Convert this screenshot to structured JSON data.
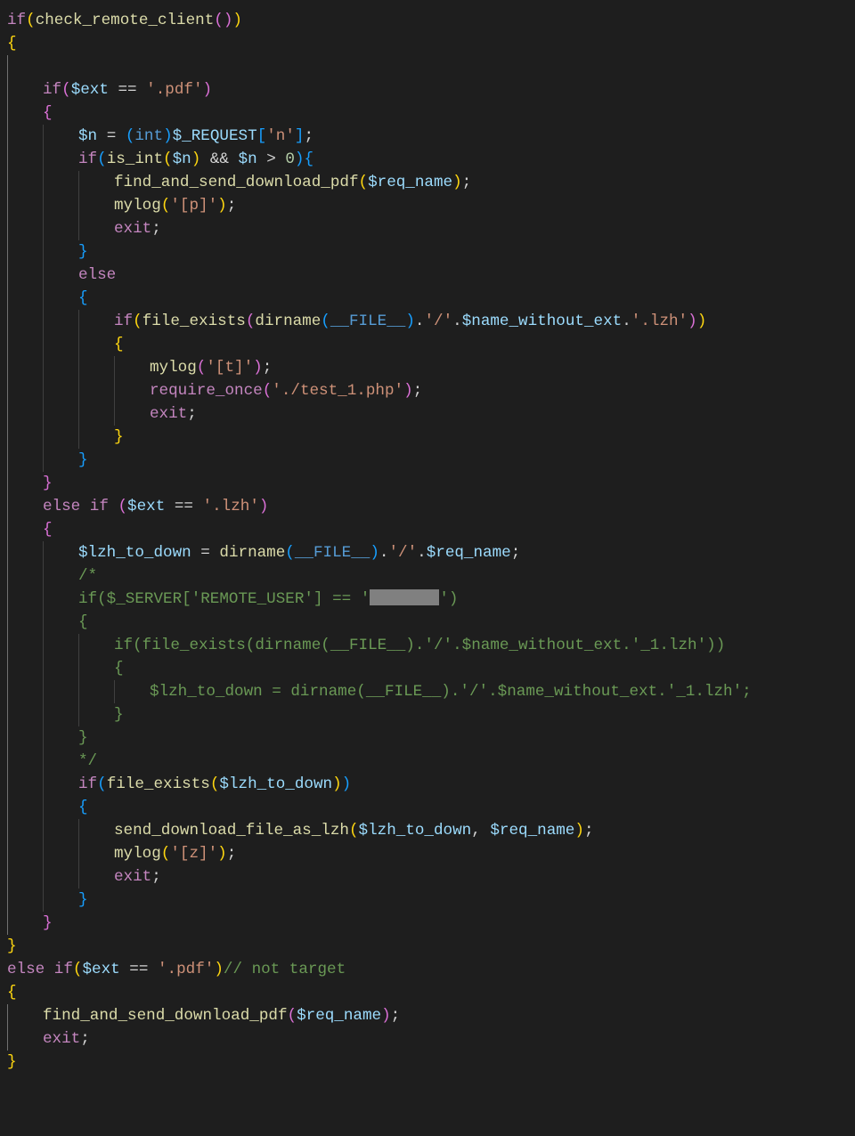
{
  "code": {
    "lines": [
      {
        "i": 0,
        "g": [],
        "h": "<span class=\"kw\">if</span><span class=\"brace\">(</span><span class=\"fn\">check_remote_client</span><span class=\"brack\">(</span><span class=\"brack\">)</span><span class=\"brace\">)</span>"
      },
      {
        "i": 0,
        "g": [],
        "h": "<span class=\"brace\">{</span>"
      },
      {
        "i": 1,
        "g": [
          "a"
        ],
        "h": ""
      },
      {
        "i": 1,
        "g": [
          "a"
        ],
        "h": "<span class=\"kw\">if</span><span class=\"brack\">(</span><span class=\"var\">$ext</span> <span class=\"op\">==</span> <span class=\"str\">'.pdf'</span><span class=\"brack\">)</span>"
      },
      {
        "i": 1,
        "g": [
          "a"
        ],
        "h": "<span class=\"brack\">{</span>"
      },
      {
        "i": 2,
        "g": [
          "a",
          "n"
        ],
        "h": "<span class=\"var\">$n</span> <span class=\"op\">=</span> <span class=\"bracb\">(</span><span class=\"con\">int</span><span class=\"bracb\">)</span><span class=\"var\">$_REQUEST</span><span class=\"bracb\">[</span><span class=\"str\">'n'</span><span class=\"bracb\">]</span>;"
      },
      {
        "i": 2,
        "g": [
          "a",
          "n"
        ],
        "h": "<span class=\"kw\">if</span><span class=\"bracb\">(</span><span class=\"fn\">is_int</span><span class=\"brace\">(</span><span class=\"var\">$n</span><span class=\"brace\">)</span> <span class=\"op\">&amp;&amp;</span> <span class=\"var\">$n</span> <span class=\"op\">&gt;</span> <span class=\"num\">0</span><span class=\"bracb\">)</span><span class=\"bracb\">{</span>"
      },
      {
        "i": 3,
        "g": [
          "a",
          "n",
          "n"
        ],
        "h": "<span class=\"fn\">find_and_send_download_pdf</span><span class=\"brace\">(</span><span class=\"var\">$req_name</span><span class=\"brace\">)</span>;"
      },
      {
        "i": 3,
        "g": [
          "a",
          "n",
          "n"
        ],
        "h": "<span class=\"fn\">mylog</span><span class=\"brace\">(</span><span class=\"str\">'[p]'</span><span class=\"brace\">)</span>;"
      },
      {
        "i": 3,
        "g": [
          "a",
          "n",
          "n"
        ],
        "h": "<span class=\"kw\">exit</span>;"
      },
      {
        "i": 2,
        "g": [
          "a",
          "n"
        ],
        "h": "<span class=\"bracb\">}</span>"
      },
      {
        "i": 2,
        "g": [
          "a",
          "n"
        ],
        "h": "<span class=\"kw\">else</span>"
      },
      {
        "i": 2,
        "g": [
          "a",
          "n"
        ],
        "h": "<span class=\"bracb\">{</span>"
      },
      {
        "i": 3,
        "g": [
          "a",
          "n",
          "n"
        ],
        "h": "<span class=\"kw\">if</span><span class=\"brace\">(</span><span class=\"fn\">file_exists</span><span class=\"brack\">(</span><span class=\"fn\">dirname</span><span class=\"bracb\">(</span><span class=\"con\">__FILE__</span><span class=\"bracb\">)</span><span class=\"op\">.</span><span class=\"str\">'/'</span><span class=\"op\">.</span><span class=\"var\">$name_without_ext</span><span class=\"op\">.</span><span class=\"str\">'.lzh'</span><span class=\"brack\">)</span><span class=\"brace\">)</span>"
      },
      {
        "i": 3,
        "g": [
          "a",
          "n",
          "n"
        ],
        "h": "<span class=\"brace\">{</span>"
      },
      {
        "i": 4,
        "g": [
          "a",
          "n",
          "n",
          "n"
        ],
        "h": "<span class=\"fn\">mylog</span><span class=\"brack\">(</span><span class=\"str\">'[t]'</span><span class=\"brack\">)</span>;"
      },
      {
        "i": 4,
        "g": [
          "a",
          "n",
          "n",
          "n"
        ],
        "h": "<span class=\"kw\">require_once</span><span class=\"brack\">(</span><span class=\"str\">'./test_1.php'</span><span class=\"brack\">)</span>;"
      },
      {
        "i": 4,
        "g": [
          "a",
          "n",
          "n",
          "n"
        ],
        "h": "<span class=\"kw\">exit</span>;"
      },
      {
        "i": 3,
        "g": [
          "a",
          "n",
          "n"
        ],
        "h": "<span class=\"brace\">}</span>"
      },
      {
        "i": 2,
        "g": [
          "a",
          "n"
        ],
        "h": "<span class=\"bracb\">}</span>"
      },
      {
        "i": 1,
        "g": [
          "a"
        ],
        "h": "<span class=\"brack\">}</span>"
      },
      {
        "i": 1,
        "g": [
          "a"
        ],
        "h": "<span class=\"kw\">else</span> <span class=\"kw\">if</span> <span class=\"brack\">(</span><span class=\"var\">$ext</span> <span class=\"op\">==</span> <span class=\"str\">'.lzh'</span><span class=\"brack\">)</span>"
      },
      {
        "i": 1,
        "g": [
          "a"
        ],
        "h": "<span class=\"brack\">{</span>"
      },
      {
        "i": 2,
        "g": [
          "a",
          "n"
        ],
        "h": "<span class=\"var\">$lzh_to_down</span> <span class=\"op\">=</span> <span class=\"fn\">dirname</span><span class=\"bracb\">(</span><span class=\"con\">__FILE__</span><span class=\"bracb\">)</span><span class=\"op\">.</span><span class=\"str\">'/'</span><span class=\"op\">.</span><span class=\"var\">$req_name</span>;"
      },
      {
        "i": 2,
        "g": [
          "a",
          "n"
        ],
        "h": "<span class=\"cmt\">/*</span>"
      },
      {
        "i": 2,
        "g": [
          "a",
          "n"
        ],
        "h": "<span class=\"cmt\">if($_SERVER['REMOTE_USER'] == '</span><span class=\"redact\"></span><span class=\"cmt\">')</span>"
      },
      {
        "i": 2,
        "g": [
          "a",
          "n"
        ],
        "h": "<span class=\"cmt\">{</span>"
      },
      {
        "i": 3,
        "g": [
          "a",
          "n",
          "n"
        ],
        "h": "<span class=\"cmt\">if(file_exists(dirname(__FILE__).'/'.$name_without_ext.'_1.lzh'))</span>"
      },
      {
        "i": 3,
        "g": [
          "a",
          "n",
          "n"
        ],
        "h": "<span class=\"cmt\">{</span>"
      },
      {
        "i": 4,
        "g": [
          "a",
          "n",
          "n",
          "n"
        ],
        "h": "<span class=\"cmt\">$lzh_to_down = dirname(__FILE__).'/'.$name_without_ext.'_1.lzh';</span>"
      },
      {
        "i": 3,
        "g": [
          "a",
          "n",
          "n"
        ],
        "h": "<span class=\"cmt\">}</span>"
      },
      {
        "i": 2,
        "g": [
          "a",
          "n"
        ],
        "h": "<span class=\"cmt\">}</span>"
      },
      {
        "i": 2,
        "g": [
          "a",
          "n"
        ],
        "h": "<span class=\"cmt\">*/</span>"
      },
      {
        "i": 2,
        "g": [
          "a",
          "n"
        ],
        "h": "<span class=\"kw\">if</span><span class=\"bracb\">(</span><span class=\"fn\">file_exists</span><span class=\"brace\">(</span><span class=\"var\">$lzh_to_down</span><span class=\"brace\">)</span><span class=\"bracb\">)</span>"
      },
      {
        "i": 2,
        "g": [
          "a",
          "n"
        ],
        "h": "<span class=\"bracb\">{</span>"
      },
      {
        "i": 3,
        "g": [
          "a",
          "n",
          "n"
        ],
        "h": "<span class=\"fn\">send_download_file_as_lzh</span><span class=\"brace\">(</span><span class=\"var\">$lzh_to_down</span>, <span class=\"var\">$req_name</span><span class=\"brace\">)</span>;"
      },
      {
        "i": 3,
        "g": [
          "a",
          "n",
          "n"
        ],
        "h": "<span class=\"fn\">mylog</span><span class=\"brace\">(</span><span class=\"str\">'[z]'</span><span class=\"brace\">)</span>;"
      },
      {
        "i": 3,
        "g": [
          "a",
          "n",
          "n"
        ],
        "h": "<span class=\"kw\">exit</span>;"
      },
      {
        "i": 2,
        "g": [
          "a",
          "n"
        ],
        "h": "<span class=\"bracb\">}</span>"
      },
      {
        "i": 1,
        "g": [
          "a"
        ],
        "h": "<span class=\"brack\">}</span>"
      },
      {
        "i": 0,
        "g": [],
        "h": "<span class=\"brace\">}</span>"
      },
      {
        "i": 0,
        "g": [],
        "h": "<span class=\"kw\">else</span> <span class=\"kw\">if</span><span class=\"brace\">(</span><span class=\"var\">$ext</span> <span class=\"op\">==</span> <span class=\"str\">'.pdf'</span><span class=\"brace\">)</span><span class=\"cmt\">// not target</span>"
      },
      {
        "i": 0,
        "g": [],
        "h": "<span class=\"brace\">{</span>"
      },
      {
        "i": 1,
        "g": [
          "a"
        ],
        "h": "<span class=\"fn\">find_and_send_download_pdf</span><span class=\"brack\">(</span><span class=\"var\">$req_name</span><span class=\"brack\">)</span>;"
      },
      {
        "i": 1,
        "g": [
          "a"
        ],
        "h": "<span class=\"kw\">exit</span>;"
      },
      {
        "i": 0,
        "g": [],
        "h": "<span class=\"brace\">}</span>"
      }
    ],
    "plain": "if(check_remote_client())\n{\n\n    if($ext == '.pdf')\n    {\n        $n = (int)$_REQUEST['n'];\n        if(is_int($n) && $n > 0){\n            find_and_send_download_pdf($req_name);\n            mylog('[p]');\n            exit;\n        }\n        else\n        {\n            if(file_exists(dirname(__FILE__).'/'.$name_without_ext.'.lzh'))\n            {\n                mylog('[t]');\n                require_once('./test_1.php');\n                exit;\n            }\n        }\n    }\n    else if ($ext == '.lzh')\n    {\n        $lzh_to_down = dirname(__FILE__).'/'.$req_name;\n        /*\n        if($_SERVER['REMOTE_USER'] == '[REDACTED]')\n        {\n            if(file_exists(dirname(__FILE__).'/'.$name_without_ext.'_1.lzh'))\n            {\n                $lzh_to_down = dirname(__FILE__).'/'.$name_without_ext.'_1.lzh';\n            }\n        }\n        */\n        if(file_exists($lzh_to_down))\n        {\n            send_download_file_as_lzh($lzh_to_down, $req_name);\n            mylog('[z]');\n            exit;\n        }\n    }\n}\nelse if($ext == '.pdf')// not target\n{\n    find_and_send_download_pdf($req_name);\n    exit;\n}"
  }
}
